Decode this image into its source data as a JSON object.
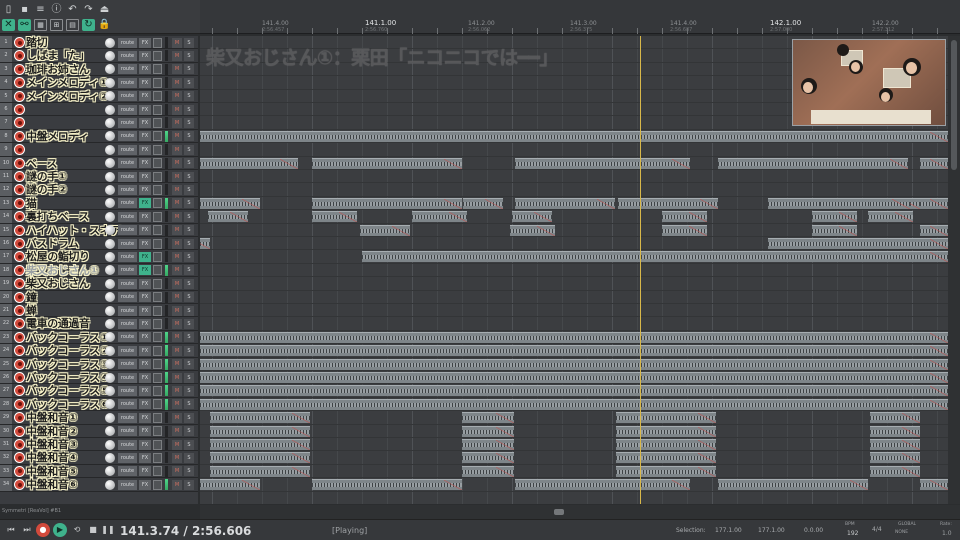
{
  "toolbar": {
    "row1_icons": [
      "new-file-icon",
      "save-icon",
      "project-settings-icon",
      "undo-history-icon",
      "undo-icon",
      "redo-icon",
      "metronome-icon"
    ],
    "row2_icons": [
      "ripple-edit-icon",
      "link-icon",
      "grid-icon",
      "snap-icon",
      "envelope-lock-icon",
      "loop-icon",
      "lock-icon"
    ]
  },
  "ruler": {
    "marks": [
      {
        "bar": "141.4.00",
        "time": "2:56.457",
        "major": false
      },
      {
        "bar": "141.1.00",
        "time": "2:56.760",
        "major": true
      },
      {
        "bar": "141.2.00",
        "time": "2:56.062",
        "major": false
      },
      {
        "bar": "141.3.00",
        "time": "2:56.375",
        "major": false
      },
      {
        "bar": "141.4.00",
        "time": "2:56.687",
        "major": false
      },
      {
        "bar": "142.1.00",
        "time": "2:57.000",
        "major": true
      },
      {
        "bar": "142.2.00",
        "time": "2:57.312",
        "major": false
      }
    ]
  },
  "overlay_title": "柴又おじさん①：栗田「ニコニコでは━━」",
  "tracks": [
    {
      "num": "1",
      "name": "踏切",
      "fx_on": false,
      "meter": false
    },
    {
      "num": "2",
      "name": "しばま「た」",
      "fx_on": false,
      "meter": false
    },
    {
      "num": "3",
      "name": "珈琲お姉さん",
      "fx_on": false,
      "meter": false
    },
    {
      "num": "4",
      "name": "メインメロディ①",
      "fx_on": false,
      "meter": false
    },
    {
      "num": "5",
      "name": "メインメロディ②",
      "fx_on": false,
      "meter": false
    },
    {
      "num": "6",
      "name": "",
      "fx_on": false,
      "meter": false
    },
    {
      "num": "7",
      "name": "",
      "fx_on": false,
      "meter": false
    },
    {
      "num": "8",
      "name": "中盤メロディ",
      "fx_on": false,
      "meter": true
    },
    {
      "num": "9",
      "name": "",
      "fx_on": false,
      "meter": false
    },
    {
      "num": "10",
      "name": "ベース",
      "fx_on": false,
      "meter": false
    },
    {
      "num": "11",
      "name": "謎の手①",
      "fx_on": false,
      "meter": false
    },
    {
      "num": "12",
      "name": "謎の手②",
      "fx_on": false,
      "meter": false
    },
    {
      "num": "13",
      "name": "猫",
      "fx_on": true,
      "meter": true
    },
    {
      "num": "14",
      "name": "裏打ちベース",
      "fx_on": false,
      "meter": false
    },
    {
      "num": "15",
      "name": "ハイハット・スネア",
      "fx_on": false,
      "meter": false
    },
    {
      "num": "16",
      "name": "バスドラム",
      "fx_on": false,
      "meter": false
    },
    {
      "num": "17",
      "name": "松屋の鮨切り",
      "fx_on": true,
      "meter": false
    },
    {
      "num": "18",
      "name": "柴又おじさん①",
      "fx_on": true,
      "meter": true,
      "dim": true
    },
    {
      "num": "19",
      "name": "柴又おじさん",
      "fx_on": false,
      "meter": false
    },
    {
      "num": "20",
      "name": "鐘",
      "fx_on": false,
      "meter": false
    },
    {
      "num": "21",
      "name": "蝉",
      "fx_on": false,
      "meter": false
    },
    {
      "num": "22",
      "name": "電車の通過音",
      "fx_on": false,
      "meter": false
    },
    {
      "num": "23",
      "name": "バックコーラス①",
      "fx_on": false,
      "meter": true
    },
    {
      "num": "24",
      "name": "バックコーラス②",
      "fx_on": false,
      "meter": true
    },
    {
      "num": "25",
      "name": "バックコーラス③",
      "fx_on": false,
      "meter": true
    },
    {
      "num": "26",
      "name": "バックコーラス④",
      "fx_on": false,
      "meter": true
    },
    {
      "num": "27",
      "name": "バックコーラス⑤",
      "fx_on": false,
      "meter": true
    },
    {
      "num": "28",
      "name": "バックコーラス⑥",
      "fx_on": false,
      "meter": true
    },
    {
      "num": "29",
      "name": "中盤和音①",
      "fx_on": false,
      "meter": false
    },
    {
      "num": "30",
      "name": "中盤和音②",
      "fx_on": false,
      "meter": false
    },
    {
      "num": "31",
      "name": "中盤和音③",
      "fx_on": false,
      "meter": false
    },
    {
      "num": "32",
      "name": "中盤和音④",
      "fx_on": false,
      "meter": false
    },
    {
      "num": "33",
      "name": "中盤和音⑤",
      "fx_on": false,
      "meter": false
    },
    {
      "num": "34",
      "name": "中盤和音⑥",
      "fx_on": false,
      "meter": true
    }
  ],
  "track_labels": {
    "route": "route",
    "fx": "FX",
    "mute": "M",
    "solo": "S"
  },
  "track_info": "Symmetri [ReaVol] #B1",
  "transport": {
    "position": "141.3.74 / 2:56.606",
    "state": "[Playing]",
    "selection_label": "Selection:",
    "selection_start": "177.1.00",
    "selection_end": "177.1.00",
    "selection_len": "0.0.00",
    "bpm_label": "BPM",
    "bpm": "192",
    "timesig": "4/4",
    "global_label": "GLOBAL",
    "global_sub": "NONE",
    "rate_label": "Rate:",
    "rate": "1.0"
  },
  "colors": {
    "accent": "#3fb28c",
    "record": "#d24a3c",
    "cursor": "#d8b84a"
  }
}
